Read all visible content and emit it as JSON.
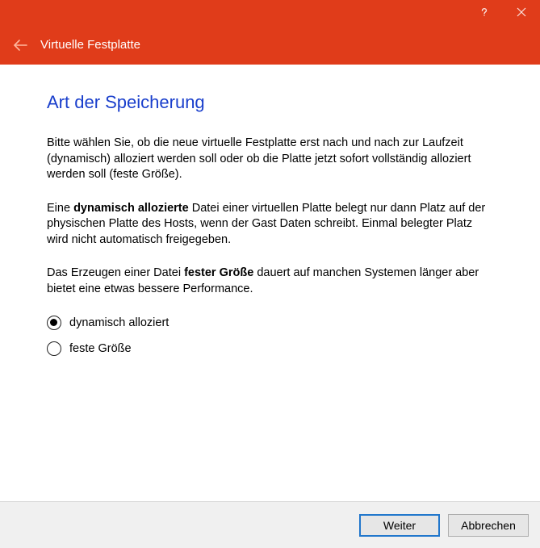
{
  "titlebar": {
    "help_icon": "help-icon",
    "close_icon": "close-icon"
  },
  "header": {
    "back_icon": "back-arrow-icon",
    "title": "Virtuelle Festplatte"
  },
  "page": {
    "title": "Art der Speicherung",
    "p1": "Bitte wählen Sie, ob die neue virtuelle Festplatte erst nach und nach zur Laufzeit (dynamisch) alloziert werden soll oder ob die Platte jetzt sofort vollständig alloziert werden soll (feste Größe).",
    "p2_a": "Eine ",
    "p2_b_bold": "dynamisch allozierte",
    "p2_c": " Datei einer virtuellen Platte belegt nur dann Platz auf der physischen Platte des Hosts, wenn der Gast Daten schreibt. Einmal belegter Platz wird nicht automatisch freigegeben.",
    "p3_a": "Das Erzeugen einer Datei ",
    "p3_b_bold": "fester Größe",
    "p3_c": " dauert auf manchen Systemen länger aber bietet eine etwas bessere Performance."
  },
  "options": {
    "dynamic": {
      "label": "dynamisch alloziert",
      "selected": true
    },
    "fixed": {
      "label": "feste Größe",
      "selected": false
    }
  },
  "footer": {
    "next": "Weiter",
    "cancel": "Abbrechen"
  }
}
